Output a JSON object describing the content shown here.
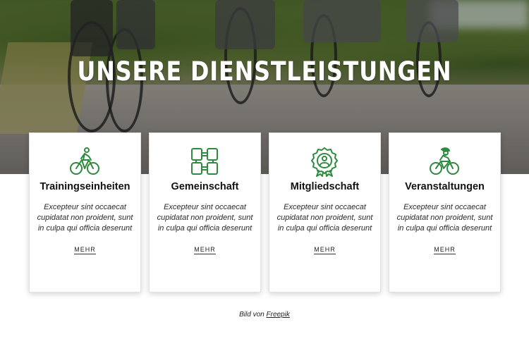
{
  "hero": {
    "title": "UNSERE DIENSTLEISTUNGEN"
  },
  "cards": [
    {
      "title": "Trainingseinheiten",
      "text": "Excepteur sint occaecat cupidatat non proident, sunt in culpa qui officia deserunt",
      "link": "MEHR",
      "icon": "cyclist-icon"
    },
    {
      "title": "Gemeinschaft",
      "text": "Excepteur sint occaecat cupidatat non proident, sunt in culpa qui officia deserunt",
      "link": "MEHR",
      "icon": "hands-together-icon"
    },
    {
      "title": "Mitgliedschaft",
      "text": "Excepteur sint occaecat cupidatat non proident, sunt in culpa qui officia deserunt",
      "link": "MEHR",
      "icon": "award-badge-icon"
    },
    {
      "title": "Veranstaltungen",
      "text": "Excepteur sint occaecat cupidatat non proident, sunt in culpa qui officia deserunt",
      "link": "MEHR",
      "icon": "racing-cyclist-icon"
    }
  ],
  "credit": {
    "prefix": "Bild von",
    "link": "Freepik"
  },
  "colors": {
    "icon": "#2e8b3e",
    "text": "#111111",
    "background": "#ffffff"
  }
}
